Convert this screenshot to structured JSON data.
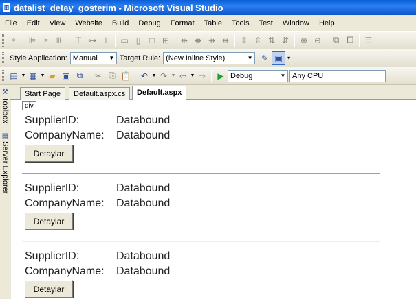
{
  "window": {
    "title": "datalist_detay_gosterim - Microsoft Visual Studio"
  },
  "menu": [
    "File",
    "Edit",
    "View",
    "Website",
    "Build",
    "Debug",
    "Format",
    "Table",
    "Tools",
    "Test",
    "Window",
    "Help"
  ],
  "style_toolbar": {
    "style_application_label": "Style Application:",
    "style_application_value": "Manual",
    "target_rule_label": "Target Rule:",
    "target_rule_value": "(New Inline Style)"
  },
  "std_toolbar": {
    "configuration": "Debug",
    "platform": "Any CPU"
  },
  "side_tabs": {
    "toolbox": "Toolbox",
    "server_explorer": "Server Explorer"
  },
  "tabs": [
    {
      "label": "Start Page"
    },
    {
      "label": "Default.aspx.cs"
    },
    {
      "label": "Default.aspx"
    }
  ],
  "design": {
    "div_tag": "div",
    "records": [
      {
        "supplier_label": "SupplierID:",
        "supplier_value": "Databound",
        "company_label": "CompanyName:",
        "company_value": "Databound",
        "button": "Detaylar"
      },
      {
        "supplier_label": "SupplierID:",
        "supplier_value": "Databound",
        "company_label": "CompanyName:",
        "company_value": "Databound",
        "button": "Detaylar"
      },
      {
        "supplier_label": "SupplierID:",
        "supplier_value": "Databound",
        "company_label": "CompanyName:",
        "company_value": "Databound",
        "button": "Detaylar"
      }
    ]
  },
  "icons": [
    "app-icon",
    "align-icon",
    "cut-icon",
    "copy-icon",
    "paste-icon",
    "undo-icon",
    "redo-icon",
    "save-icon",
    "open-icon",
    "new-project-icon",
    "start-debug-icon",
    "new-style-icon",
    "manage-styles-icon"
  ],
  "colors": {
    "title_bar": "#0a5fd8",
    "chrome": "#ece9d8",
    "selection": "#316ac5"
  }
}
